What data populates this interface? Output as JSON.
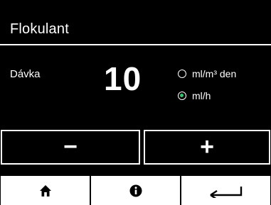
{
  "header": {
    "title": "Flokulant"
  },
  "dose": {
    "label": "Dávka",
    "value": "10"
  },
  "units": {
    "options": [
      {
        "label": "ml/m³ den",
        "selected": false
      },
      {
        "label": "ml/h",
        "selected": true
      }
    ],
    "selected_color": "#2ec86a"
  },
  "stepper": {
    "decrease_label": "−",
    "increase_label": "+"
  },
  "nav": {
    "home_icon": "home-icon",
    "info_icon": "info-icon",
    "back_icon": "back-arrow-icon"
  }
}
